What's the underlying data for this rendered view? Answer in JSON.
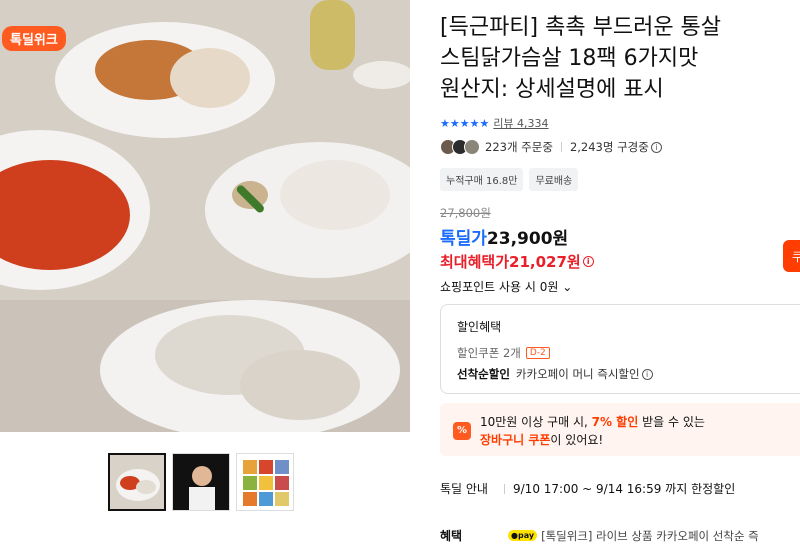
{
  "badge": {
    "label": "톡딜위크"
  },
  "product": {
    "title_line1": "[득근파티] 촉촉 부드러운 통살",
    "title_line2": "스팀닭가슴살 18팩 6가지맛",
    "title_line3": "원산지: 상세설명에 표시",
    "stars": "★★★★★",
    "review_label": "리뷰 4,334",
    "orders": "223개 주문중",
    "views": "2,243명 구경중",
    "tags": [
      "누적구매 16.8만",
      "무료배송"
    ],
    "original_price": "27,800원",
    "deal_label": "톡딜가",
    "deal_price": "23,900원",
    "max_benefit_label": "최대혜택가",
    "max_benefit_price": "21,027원",
    "points_label": "쇼핑포인트 사용 시 0원"
  },
  "discount": {
    "header": "할인혜택",
    "coupon_label": "할인쿠폰 2개",
    "coupon_dday": "D-2",
    "first_come_label": "선착순할인",
    "first_come_desc": "카카오페이 머니 즉시할인"
  },
  "promo": {
    "icon": "%",
    "line1_pre": "10만원 이상 구매 시, ",
    "line1_highlight": "7% 할인",
    "line1_post": " 받을 수 있는",
    "line2_highlight": "장바구니 쿠폰",
    "line2_post": "이 있어요!"
  },
  "deal_info": {
    "label": "톡딜 안내",
    "value": "9/10 17:00 ~ 9/14 16:59 까지 한정할인"
  },
  "benefit": {
    "label": "혜택",
    "pay_badge": "●pay",
    "text": "[톡딜위크] 라이브 상품 카카오페이 선착순 즉"
  },
  "side_button": {
    "label": "쿠"
  },
  "colors": {
    "accent": "#1a6cff",
    "sale": "#e8202a",
    "brand": "#ff5a1f"
  }
}
